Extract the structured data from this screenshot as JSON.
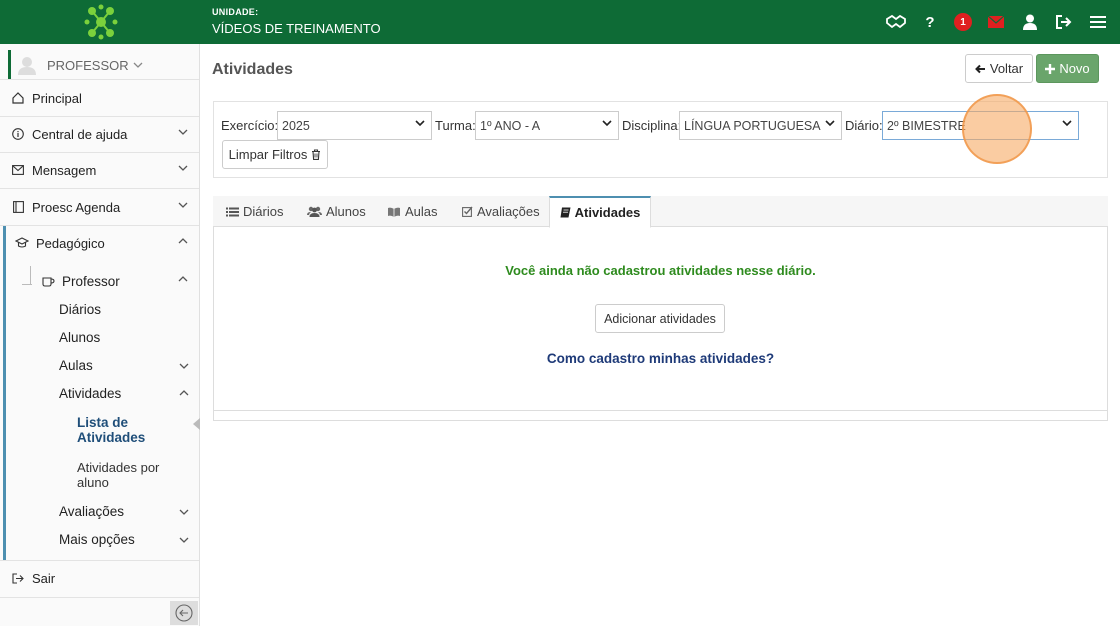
{
  "header": {
    "unit_label": "UNIDADE:",
    "unit_name": "VÍDEOS DE TREINAMENTO",
    "notification_count": "1",
    "icons": [
      "handshake-icon",
      "help-icon",
      "notification-badge",
      "mail-icon",
      "user-icon",
      "logout-icon",
      "menu-icon"
    ],
    "brand_color": "#0e6b36"
  },
  "sidebar": {
    "profile": "PROFESSOR",
    "items": [
      {
        "label": "Principal"
      },
      {
        "label": "Central de ajuda"
      },
      {
        "label": "Mensagem"
      },
      {
        "label": "Proesc Agenda"
      },
      {
        "label": "Pedagógico"
      },
      {
        "label": "Sair"
      }
    ],
    "professor": "Professor",
    "sub": {
      "diarios": "Diários",
      "alunos": "Alunos",
      "aulas": "Aulas",
      "atividades": "Atividades",
      "lista": "Lista de Atividades",
      "por_aluno": "Atividades por aluno",
      "avaliacoes": "Avaliações",
      "mais": "Mais opções"
    }
  },
  "main": {
    "title": "Atividades",
    "voltar": "Voltar",
    "novo": "Novo",
    "filters": {
      "exercicio_label": "Exercício:",
      "exercicio_value": "2025",
      "turma_label": "Turma:",
      "turma_value": "1º ANO - A",
      "disciplina_label": "Disciplina:",
      "disciplina_value": "LÍNGUA PORTUGUESA",
      "diario_label": "Diário:",
      "diario_value": "2º BIMESTRE",
      "limpar": "Limpar Filtros"
    },
    "tabs": [
      {
        "label": "Diários"
      },
      {
        "label": "Alunos"
      },
      {
        "label": "Aulas"
      },
      {
        "label": "Avaliações"
      },
      {
        "label": "Atividades"
      }
    ],
    "empty_message": "Você ainda não cadastrou atividades nesse diário.",
    "add_button": "Adicionar atividades",
    "howto_link": "Como cadastro minhas atividades?"
  }
}
